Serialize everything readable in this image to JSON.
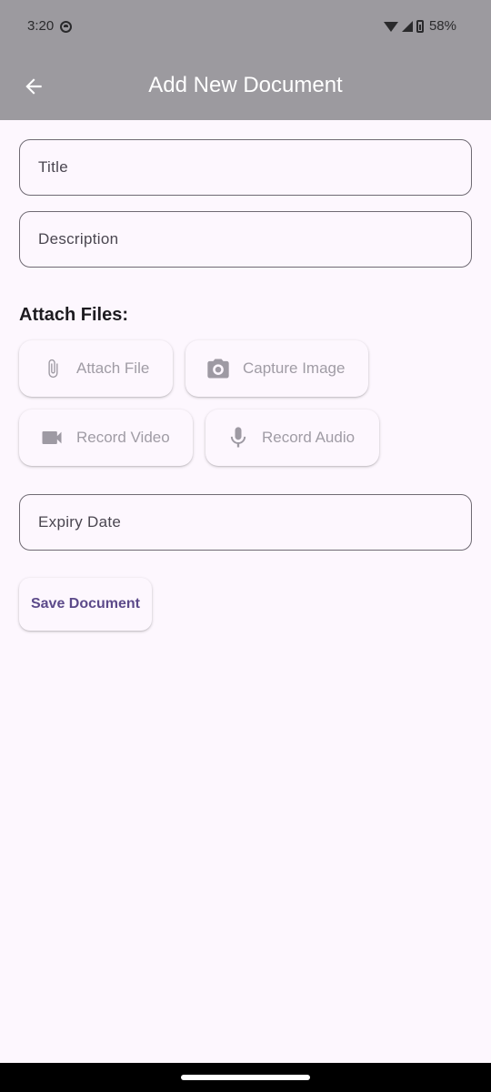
{
  "status_bar": {
    "time": "3:20",
    "battery": "58%"
  },
  "app_bar": {
    "title": "Add New Document",
    "back_icon": "arrow-left-icon"
  },
  "form": {
    "title_label": "Title",
    "description_label": "Description",
    "attach_section_label": "Attach Files:",
    "attach_file_label": "Attach File",
    "capture_image_label": "Capture Image",
    "record_video_label": "Record Video",
    "record_audio_label": "Record Audio",
    "expiry_date_label": "Expiry Date",
    "save_label": "Save Document"
  },
  "colors": {
    "app_bar": "#9c9a9f",
    "background": "#fdf7fe",
    "accent": "#5c4a8a",
    "disabled_text": "#a09ca5"
  }
}
